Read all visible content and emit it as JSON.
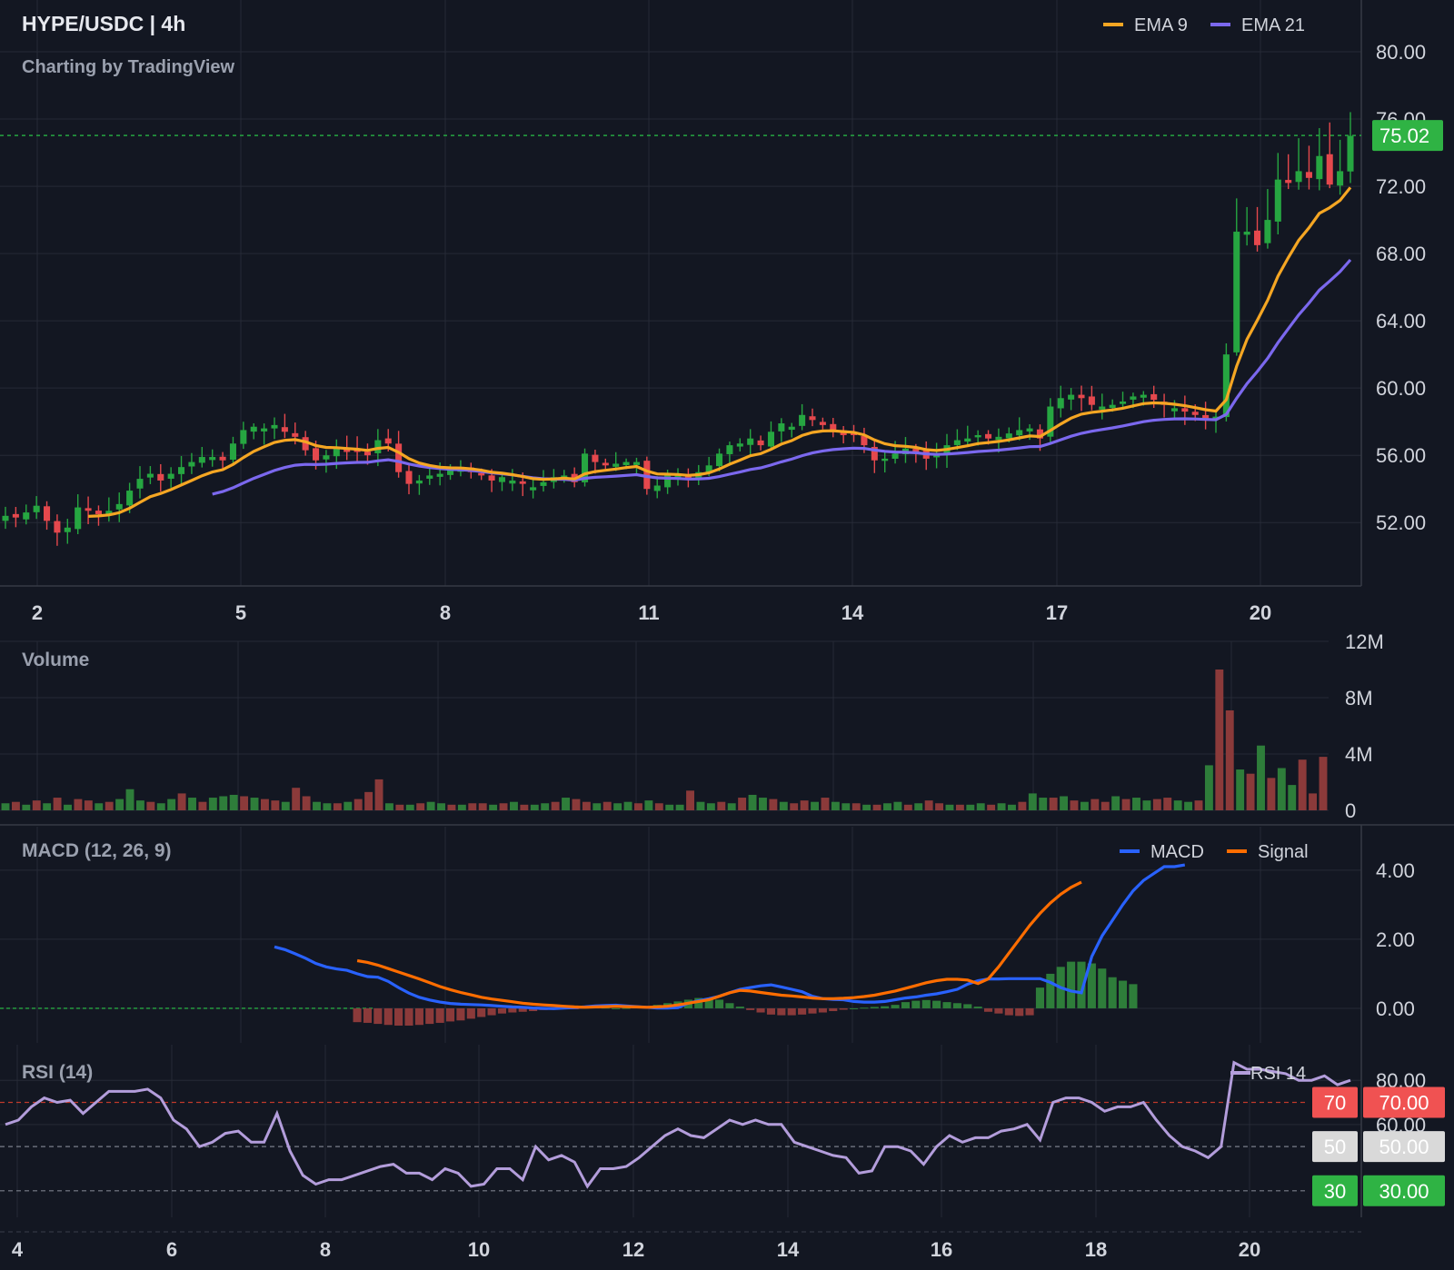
{
  "header": {
    "title": "HYPE/USDC | 4h",
    "subtitle": "Charting by TradingView"
  },
  "colors": {
    "background": "#131722",
    "up": "#26a641",
    "down": "#e5484d",
    "ema9": "#f5a623",
    "ema21": "#7b68ee",
    "macd": "#2962ff",
    "signal": "#ff6d00",
    "rsi": "#b39ddb",
    "price_line": "#26a641"
  },
  "price_panel": {
    "legend": [
      {
        "name": "EMA 9",
        "color": "#f5a623"
      },
      {
        "name": "EMA 21",
        "color": "#7b68ee"
      }
    ],
    "y_ticks": [
      "80.00",
      "76.00",
      "72.00",
      "68.00",
      "64.00",
      "60.00",
      "56.00",
      "52.00"
    ],
    "last_price": "75.02",
    "x_ticks": [
      "2",
      "5",
      "8",
      "11",
      "14",
      "17",
      "20"
    ]
  },
  "volume_panel": {
    "title": "Volume",
    "y_ticks": [
      "12M",
      "8M",
      "4M",
      "0"
    ]
  },
  "macd_panel": {
    "title": "MACD (12, 26, 9)",
    "legend": [
      {
        "name": "MACD",
        "color": "#2962ff"
      },
      {
        "name": "Signal",
        "color": "#ff6d00"
      }
    ],
    "y_ticks": [
      "4.00",
      "2.00",
      "0.00"
    ]
  },
  "rsi_panel": {
    "title": "RSI (14)",
    "legend": [
      {
        "name": "RSI 14",
        "color": "#b39ddb"
      }
    ],
    "y_ticks": [
      "80.00",
      "60.00"
    ],
    "level_badges": [
      {
        "inner": "70",
        "outer": "70.00",
        "color": "#f05252"
      },
      {
        "inner": "50",
        "outer": "50.00",
        "color": "#d9d9d9"
      },
      {
        "inner": "30",
        "outer": "30.00",
        "color": "#2fb344"
      }
    ],
    "x_ticks": [
      "4",
      "6",
      "8",
      "10",
      "12",
      "14",
      "16",
      "18",
      "20"
    ]
  },
  "chart_data": [
    {
      "type": "candlestick",
      "title": "HYPE/USDC | 4h",
      "ylim": [
        48.5,
        82
      ],
      "x_ticks": [
        "2",
        "5",
        "8",
        "11",
        "14",
        "17",
        "20"
      ],
      "close": [
        52.4,
        52.3,
        52.6,
        53.0,
        52.1,
        51.4,
        51.7,
        52.9,
        52.7,
        52.5,
        52.7,
        53.1,
        53.9,
        54.6,
        54.9,
        54.5,
        54.9,
        55.3,
        55.6,
        55.9,
        55.9,
        55.7,
        56.7,
        57.5,
        57.7,
        57.6,
        57.8,
        57.4,
        57.1,
        56.3,
        55.7,
        56.0,
        56.4,
        56.2,
        56.2,
        56.0,
        56.9,
        56.7,
        55.0,
        54.3,
        54.5,
        54.8,
        54.9,
        55.1,
        55.2,
        55.0,
        54.8,
        54.5,
        54.7,
        54.5,
        54.3,
        54.1,
        54.4,
        54.7,
        54.8,
        54.4,
        56.1,
        55.6,
        55.4,
        55.5,
        55.6,
        55.6,
        54.0,
        54.2,
        54.8,
        54.8,
        54.6,
        55.0,
        55.4,
        56.1,
        56.6,
        56.7,
        57.0,
        56.6,
        57.4,
        57.9,
        57.7,
        58.4,
        58.1,
        57.8,
        57.5,
        57.2,
        57.2,
        56.6,
        55.7,
        55.8,
        56.1,
        56.4,
        56.2,
        55.8,
        56.1,
        56.6,
        56.9,
        57.0,
        57.2,
        57.0,
        57.1,
        57.3,
        57.5,
        57.6,
        57.0,
        58.9,
        59.4,
        59.6,
        59.4,
        59.0,
        58.9,
        59.0,
        59.2,
        59.5,
        59.6,
        59.3,
        59.0,
        58.8,
        58.6,
        58.4,
        58.2,
        58.3,
        62.0,
        69.3,
        69.3,
        68.5,
        70.0,
        72.4,
        72.2,
        72.9,
        72.5,
        73.8,
        72.1,
        72.9,
        75.0
      ],
      "ema9_start_index": 8,
      "ema21_start_index": 20
    },
    {
      "type": "bar",
      "title": "Volume",
      "ylim": [
        0,
        12
      ],
      "unit": "M",
      "values": [
        0.5,
        0.6,
        0.4,
        0.7,
        0.5,
        0.9,
        0.4,
        0.8,
        0.7,
        0.5,
        0.6,
        0.8,
        1.5,
        0.7,
        0.6,
        0.5,
        0.8,
        1.2,
        0.9,
        0.6,
        0.9,
        1.0,
        1.1,
        1.0,
        0.9,
        0.8,
        0.7,
        0.6,
        1.6,
        1.0,
        0.6,
        0.5,
        0.5,
        0.6,
        0.8,
        1.3,
        2.2,
        0.5,
        0.4,
        0.4,
        0.5,
        0.6,
        0.5,
        0.4,
        0.4,
        0.5,
        0.5,
        0.4,
        0.5,
        0.6,
        0.4,
        0.4,
        0.5,
        0.6,
        0.9,
        0.8,
        0.6,
        0.5,
        0.6,
        0.5,
        0.6,
        0.5,
        0.7,
        0.5,
        0.4,
        0.4,
        1.4,
        0.6,
        0.5,
        0.6,
        0.5,
        0.9,
        1.1,
        0.9,
        0.8,
        0.6,
        0.5,
        0.7,
        0.6,
        0.9,
        0.6,
        0.5,
        0.5,
        0.4,
        0.4,
        0.5,
        0.6,
        0.4,
        0.5,
        0.7,
        0.5,
        0.4,
        0.4,
        0.4,
        0.5,
        0.4,
        0.5,
        0.4,
        0.6,
        1.2,
        0.9,
        0.9,
        1.0,
        0.7,
        0.6,
        0.8,
        0.6,
        1.0,
        0.8,
        0.9,
        0.7,
        0.8,
        0.9,
        0.7,
        0.6,
        0.7,
        3.2,
        10.0,
        7.1,
        2.9,
        2.6,
        4.6,
        2.3,
        3.0,
        1.8,
        3.6,
        1.2,
        3.8
      ],
      "up_flags": [
        1,
        0,
        1,
        0,
        1,
        0,
        1,
        0,
        0,
        1,
        0,
        1,
        1,
        1,
        0,
        1,
        1,
        0,
        1,
        0,
        1,
        1,
        1,
        0,
        1,
        0,
        0,
        1,
        0,
        0,
        1,
        1,
        0,
        1,
        0,
        0,
        0,
        1,
        0,
        1,
        0,
        1,
        1,
        0,
        1,
        0,
        0,
        1,
        0,
        1,
        0,
        1,
        1,
        0,
        1,
        0,
        0,
        1,
        0,
        1,
        1,
        0,
        1,
        0,
        1,
        1,
        0,
        1,
        1,
        0,
        1,
        0,
        1,
        1,
        0,
        1,
        0,
        0,
        1,
        0,
        1,
        1,
        0,
        1,
        0,
        1,
        1,
        0,
        1,
        0,
        0,
        1,
        0,
        1,
        1,
        0,
        1,
        1,
        0,
        1,
        1,
        0,
        1,
        0,
        1,
        0,
        0,
        1,
        0,
        1,
        1,
        0,
        0,
        1,
        1,
        0,
        1,
        0,
        0,
        1,
        0,
        1,
        0,
        1,
        1
      ]
    },
    {
      "type": "line",
      "title": "MACD (12, 26, 9)",
      "ylim": [
        -1.0,
        4.6
      ],
      "series": [
        {
          "name": "MACD",
          "start_index": 26,
          "values": [
            1.78,
            1.7,
            1.58,
            1.45,
            1.3,
            1.2,
            1.14,
            1.1,
            1.0,
            0.92,
            0.9,
            0.78,
            0.6,
            0.44,
            0.32,
            0.24,
            0.18,
            0.14,
            0.12,
            0.11,
            0.1,
            0.08,
            0.06,
            0.04,
            0.03,
            0.01,
            0.0,
            -0.01,
            0.01,
            0.02,
            0.04,
            0.07,
            0.08,
            0.09,
            0.07,
            0.05,
            0.03,
            0.01,
            0.01,
            0.02,
            0.15,
            0.22,
            0.28,
            0.35,
            0.45,
            0.55,
            0.6,
            0.65,
            0.68,
            0.62,
            0.55,
            0.48,
            0.35,
            0.28,
            0.26,
            0.25,
            0.2,
            0.18,
            0.18,
            0.2,
            0.25,
            0.3,
            0.33,
            0.38,
            0.42,
            0.48,
            0.55,
            0.7,
            0.8,
            0.85,
            0.85,
            0.86,
            0.86,
            0.86,
            0.86,
            0.75,
            0.6,
            0.5,
            0.45,
            1.5,
            2.1,
            2.55,
            3.0,
            3.4,
            3.7,
            3.9,
            4.1,
            4.1,
            4.15
          ]
        },
        {
          "name": "Signal",
          "start_index": 34,
          "values": [
            1.38,
            1.33,
            1.25,
            1.15,
            1.05,
            0.95,
            0.85,
            0.74,
            0.63,
            0.54,
            0.46,
            0.39,
            0.32,
            0.27,
            0.23,
            0.19,
            0.15,
            0.12,
            0.1,
            0.08,
            0.06,
            0.04,
            0.03,
            0.04,
            0.05,
            0.06,
            0.05,
            0.04,
            0.03,
            0.04,
            0.06,
            0.1,
            0.15,
            0.2,
            0.25,
            0.35,
            0.45,
            0.52,
            0.5,
            0.46,
            0.42,
            0.38,
            0.36,
            0.33,
            0.3,
            0.28,
            0.28,
            0.29,
            0.31,
            0.34,
            0.38,
            0.44,
            0.5,
            0.58,
            0.66,
            0.74,
            0.8,
            0.84,
            0.84,
            0.82,
            0.72,
            0.85,
            1.2,
            1.6,
            2.0,
            2.4,
            2.75,
            3.05,
            3.3,
            3.5,
            3.65
          ]
        }
      ],
      "histogram_start_index": 34,
      "histogram": [
        -0.4,
        -0.42,
        -0.45,
        -0.48,
        -0.5,
        -0.5,
        -0.48,
        -0.45,
        -0.42,
        -0.38,
        -0.35,
        -0.3,
        -0.25,
        -0.2,
        -0.15,
        -0.12,
        -0.1,
        -0.08,
        -0.05,
        -0.03,
        -0.02,
        -0.01,
        0.02,
        0.03,
        0.02,
        0.0,
        0.01,
        0.03,
        0.05,
        0.1,
        0.15,
        0.2,
        0.25,
        0.3,
        0.3,
        0.25,
        0.15,
        0.05,
        -0.05,
        -0.12,
        -0.18,
        -0.2,
        -0.2,
        -0.18,
        -0.15,
        -0.12,
        -0.08,
        -0.04,
        0.0,
        0.02,
        0.04,
        0.06,
        0.1,
        0.18,
        0.22,
        0.24,
        0.22,
        0.18,
        0.15,
        0.12,
        0.05,
        -0.1,
        -0.15,
        -0.2,
        -0.22,
        -0.2,
        0.6,
        1.0,
        1.2,
        1.35,
        1.35,
        1.3,
        1.15,
        0.9,
        0.8,
        0.7
      ]
    },
    {
      "type": "line",
      "title": "RSI (14)",
      "ylim": [
        18,
        92
      ],
      "levels": [
        70,
        50,
        30
      ],
      "series": [
        {
          "name": "RSI 14",
          "values": [
            60,
            62,
            68,
            72,
            70,
            71,
            65,
            70,
            75,
            75,
            75,
            76,
            72,
            62,
            58,
            50,
            52,
            56,
            57,
            52,
            52,
            65,
            48,
            37,
            33,
            35,
            35,
            37,
            39,
            41,
            42,
            38,
            38,
            35,
            40,
            38,
            32,
            33,
            40,
            40,
            35,
            50,
            44,
            46,
            43,
            32,
            40,
            40,
            41,
            45,
            50,
            55,
            58,
            55,
            54,
            58,
            62,
            60,
            62,
            60,
            60,
            52,
            50,
            48,
            46,
            45,
            38,
            39,
            50,
            50,
            48,
            42,
            50,
            55,
            52,
            54,
            54,
            57,
            58,
            60,
            53,
            70,
            72,
            72,
            70,
            66,
            68,
            68,
            70,
            62,
            55,
            50,
            48,
            45,
            50,
            88,
            85,
            85,
            84,
            83,
            80,
            80,
            82,
            78,
            80
          ]
        }
      ],
      "x_ticks": [
        "4",
        "6",
        "8",
        "10",
        "12",
        "14",
        "16",
        "18",
        "20"
      ]
    }
  ]
}
